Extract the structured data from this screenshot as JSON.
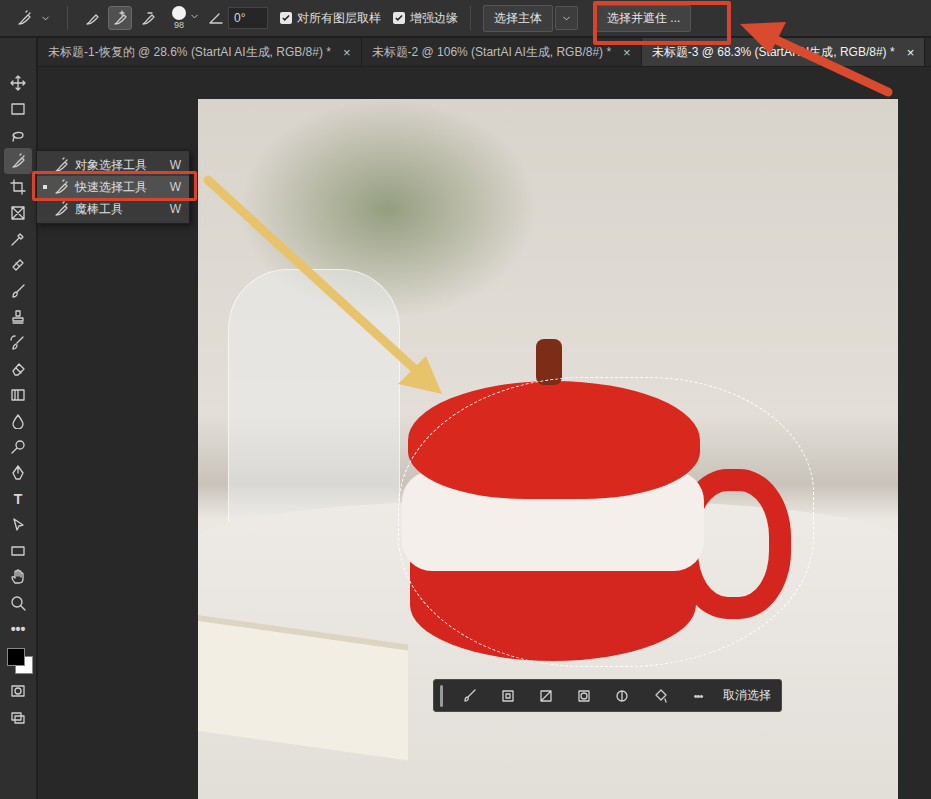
{
  "window": {
    "app": "Photoshop"
  },
  "options_bar": {
    "brush_modes": [
      {
        "kind": "new",
        "selected": false
      },
      {
        "kind": "add",
        "selected": true
      },
      {
        "kind": "subtract",
        "selected": false
      }
    ],
    "brush_size": "98",
    "angle": "0°",
    "checkboxes": [
      {
        "label": "对所有图层取样",
        "checked": true
      },
      {
        "label": "增强边缘",
        "checked": true
      }
    ],
    "select_subject": "选择主体",
    "select_and_mask": "选择并遮住 ..."
  },
  "tabs": [
    {
      "label": "未标题-1-恢复的 @ 28.6% (StartAI AI生成, RGB/8#) *",
      "close": "×",
      "selected": false
    },
    {
      "label": "未标题-2 @ 106% (StartAI AI生成, RGB/8#) *",
      "close": "×",
      "selected": false
    },
    {
      "label": "未标题-3 @ 68.3% (StartAI AI生成, RGB/8#) *",
      "close": "×",
      "selected": true
    }
  ],
  "toolbar": {
    "tools": [
      {
        "kind": "move",
        "selected": false
      },
      {
        "kind": "marquee",
        "selected": false
      },
      {
        "kind": "lasso",
        "selected": false
      },
      {
        "kind": "quick-select",
        "selected": true
      },
      {
        "kind": "crop",
        "selected": false
      },
      {
        "kind": "frame",
        "selected": false
      },
      {
        "kind": "eyedropper",
        "selected": false
      },
      {
        "kind": "healing",
        "selected": false
      },
      {
        "kind": "brush",
        "selected": false
      },
      {
        "kind": "stamp",
        "selected": false
      },
      {
        "kind": "history-brush",
        "selected": false
      },
      {
        "kind": "eraser",
        "selected": false
      },
      {
        "kind": "gradient",
        "selected": false
      },
      {
        "kind": "blur",
        "selected": false
      },
      {
        "kind": "dodge",
        "selected": false
      },
      {
        "kind": "pen",
        "selected": false
      },
      {
        "kind": "text",
        "label": "T",
        "selected": false
      },
      {
        "kind": "path-select",
        "selected": false
      },
      {
        "kind": "rectangle",
        "selected": false
      },
      {
        "kind": "hand",
        "selected": false
      },
      {
        "kind": "zoom",
        "selected": false
      },
      {
        "kind": "more",
        "label": "•••",
        "selected": false
      },
      {
        "kind": "colors",
        "foreground": "#000000",
        "background": "#ffffff",
        "selected": false
      },
      {
        "kind": "quick-mask",
        "selected": false
      },
      {
        "kind": "screen-mode",
        "selected": false
      }
    ]
  },
  "tool_flyout": {
    "items": [
      {
        "label": "对象选择工具",
        "shortcut": "W",
        "selected": false
      },
      {
        "label": "快速选择工具",
        "shortcut": "W",
        "selected": true
      },
      {
        "label": "魔棒工具",
        "shortcut": "W",
        "selected": false
      }
    ]
  },
  "contextual_taskbar": {
    "buttons": [
      {
        "kind": "modify"
      },
      {
        "kind": "select-mask"
      },
      {
        "kind": "invert"
      },
      {
        "kind": "mask"
      },
      {
        "kind": "half"
      },
      {
        "kind": "fill"
      }
    ],
    "more": "•••",
    "deselect": "取消选择"
  }
}
